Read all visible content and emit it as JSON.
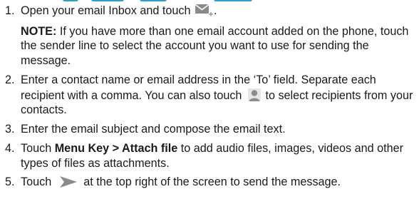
{
  "steps": [
    {
      "number": "1.",
      "text_before_icon": "Open your email Inbox and touch",
      "text_after_icon": ".",
      "icon": "compose-email-icon",
      "note_label": "NOTE:",
      "note_text": "If you have more than one email account added on the phone, touch the sender line to select the account you want to use for sending the message."
    },
    {
      "number": "2.",
      "text": "Enter a contact name or email address in the ‘To’ field. Separate each recipient with a comma. You can also touch",
      "icon": "contact-person-icon",
      "text_after_icon": "to select recipients from your contacts."
    },
    {
      "number": "3.",
      "text": "Enter the email subject and compose the email text."
    },
    {
      "number": "4.",
      "text_before_bold": "Touch",
      "bold_text": "Menu Key > Attach file",
      "text_after_bold": "to add audio files, images, videos and other types of files as attachments."
    },
    {
      "number": "5.",
      "text_before_icon": "Touch",
      "icon": "send-icon",
      "text_after_icon": "at the top right of the screen to send the message."
    }
  ],
  "colors": {
    "text": "#1a1a1a",
    "icon_gray": "#8a8a8a",
    "accent_blue": "#2a9fd6"
  }
}
